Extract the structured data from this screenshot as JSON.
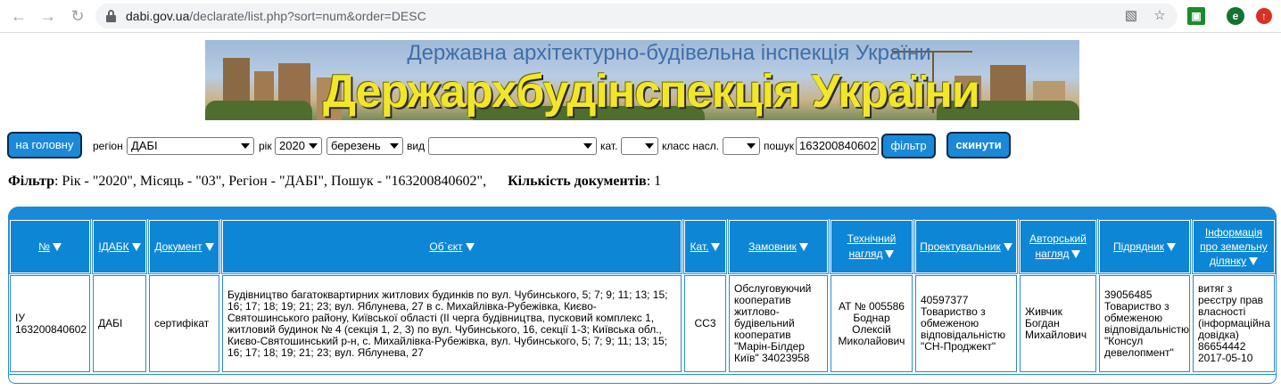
{
  "browser": {
    "url_domain": "dabi.gov.ua",
    "url_rest": "/declarate/list.php?sort=num&order=DESC",
    "profile_letter": "e"
  },
  "banner": {
    "subtitle": "Державна архітектурно-будівельна інспекція України",
    "title": "Держархбудінспекція України"
  },
  "filters": {
    "home_label": "на головну",
    "region_label": "регіон",
    "region_value": "ДАБІ",
    "year_label": "рік",
    "year_value": "2020",
    "month_value": "березень",
    "type_label": "вид",
    "type_value": "",
    "cat_label": "кат.",
    "cat_value": "",
    "class_label": "класс насл.",
    "class_value": "",
    "search_label": "пошук",
    "search_value": "163200840602",
    "filter_label": "фільтр",
    "reset_label": "скинути"
  },
  "summary": {
    "filter_label": "Фільтр",
    "filter_text": ": Рік - \"2020\", Місяць - \"03\", Регіон - \"ДАБІ\", Пошук - \"163200840602\",",
    "count_label": "Кількість документів",
    "count_text": ": 1"
  },
  "table": {
    "headers": {
      "num": "№",
      "idabk": "ІДАБК",
      "document": "Документ",
      "object": "Об`єкт",
      "cat": "Кат.",
      "customer": "Замовник",
      "tech_1": "Технічний",
      "tech_2": "нагляд",
      "designer": "Проектувальник",
      "author_1": "Авторський",
      "author_2": "нагляд",
      "contractor": "Підрядник",
      "land_1": "Інформація",
      "land_2": "про земельну",
      "land_3": "ділянку"
    },
    "row": {
      "num_1": "ІУ",
      "num_2": "163200840602",
      "idabk": "ДАБІ",
      "document": "сертифікат",
      "object": "Будівництво багатоквартирних житлових будинків по вул. Чубинського, 5; 7; 9; 11; 13; 15; 16; 17; 18; 19; 21; 23; вул. Яблунева, 27 в с. Михайлівка-Рубежівка, Києво-Святошинського району, Київської області (ІІ черга будівництва, пусковий комплекс 1, житловий будинок № 4 (секція 1, 2, 3) по вул. Чубинського, 16, секції 1-3; Київська обл., Києво-Святошинський р-н, с. Михайлівка-Рубежівка, вул. Чубинського, 5; 7; 9; 11; 13; 15; 16; 17; 18; 19; 21; 23; вул. Яблунева, 27",
      "cat": "СС3",
      "customer": "Обслуговуючий кооператив житлово-будівельний кооператив \"Марін-Білдер Київ\" 34023958",
      "tech": "АТ № 005586 Боднар Олексій Миколайович",
      "designer": "40597377 Товариство з обмеженою відповідальністю \"СН-Проджект\"",
      "author": "Живчик Богдан Михайлович",
      "contractor": "39056485 Товариство з обмеженою відповідальністю \"Консул девелопмент\"",
      "land": "витяг з реєстру прав власності (інформаційна довідка) 86654442 2017-05-10"
    }
  }
}
